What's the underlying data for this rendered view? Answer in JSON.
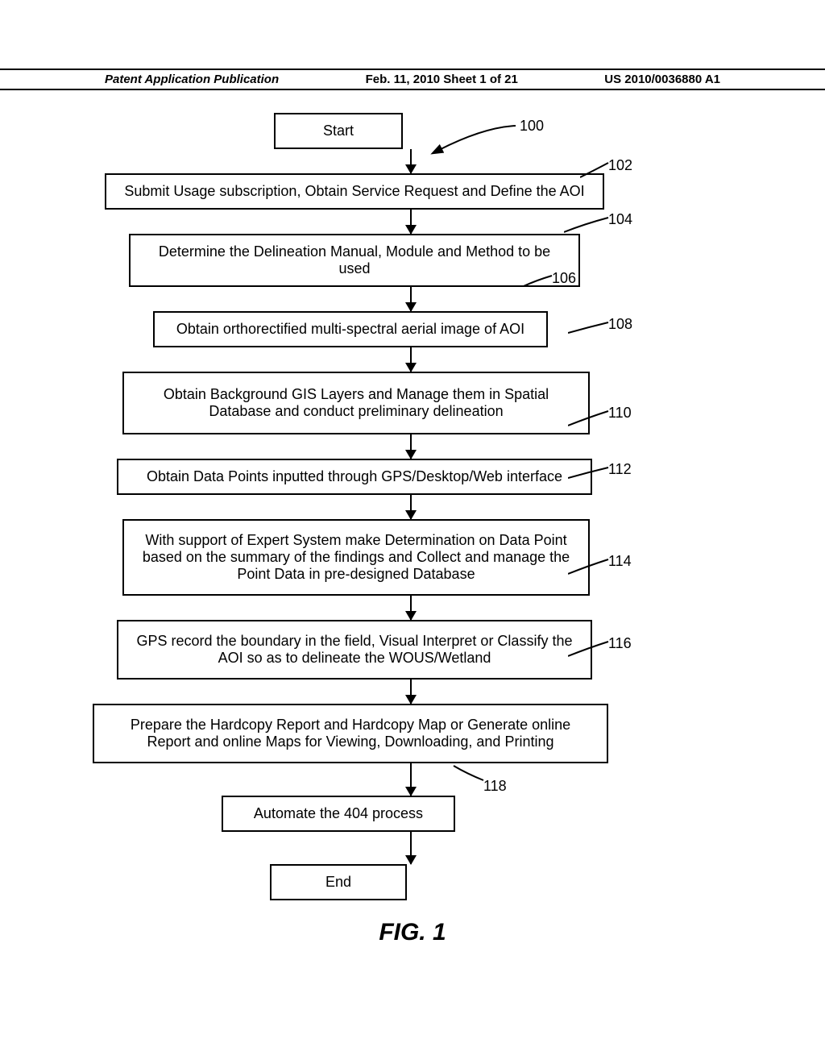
{
  "header": {
    "left": "Patent Application Publication",
    "center": "Feb. 11, 2010  Sheet 1 of 21",
    "right": "US 2010/0036880 A1"
  },
  "boxes": {
    "start": "Start",
    "b102": "Submit Usage subscription, Obtain Service Request and Define the AOI",
    "b104": "Determine the Delineation Manual, Module and Method to be used",
    "b106": "Obtain orthorectified multi-spectral aerial image of AOI",
    "b108": "Obtain Background GIS Layers and Manage them in Spatial Database and conduct preliminary delineation",
    "b110": "Obtain Data Points inputted through GPS/Desktop/Web interface",
    "b112": "With support of Expert System make Determination on Data Point based on the summary of the findings and Collect and manage the Point Data in pre-designed Database",
    "b114": "GPS record the boundary in the field, Visual Interpret or Classify the AOI so as to delineate the WOUS/Wetland",
    "b116": "Prepare the Hardcopy Report and Hardcopy Map or Generate online Report and online Maps for Viewing, Downloading, and Printing",
    "b118": "Automate the 404 process",
    "end": "End"
  },
  "refs": {
    "r100": "100",
    "r102": "102",
    "r104": "104",
    "r106": "106",
    "r108": "108",
    "r110": "110",
    "r112": "112",
    "r114": "114",
    "r116": "116",
    "r118": "118"
  },
  "figure_label": "FIG. 1",
  "chart_data": {
    "type": "flowchart",
    "title": "FIG. 1",
    "nodes": [
      {
        "id": "start",
        "ref": null,
        "label": "Start",
        "shape": "rect"
      },
      {
        "id": "102",
        "ref": "102",
        "label": "Submit Usage subscription, Obtain Service Request and Define the AOI",
        "shape": "rect"
      },
      {
        "id": "104",
        "ref": "104",
        "label": "Determine the Delineation Manual, Module and Method to be used",
        "shape": "rect"
      },
      {
        "id": "106",
        "ref": "106",
        "label": "Obtain orthorectified multi-spectral aerial image of AOI",
        "shape": "rect"
      },
      {
        "id": "108",
        "ref": "108",
        "label": "Obtain Background GIS Layers and Manage them in Spatial Database and conduct preliminary delineation",
        "shape": "rect"
      },
      {
        "id": "110",
        "ref": "110",
        "label": "Obtain Data Points inputted through GPS/Desktop/Web interface",
        "shape": "rect"
      },
      {
        "id": "112",
        "ref": "112",
        "label": "With support of Expert System make Determination on Data Point based on the summary of the findings and Collect and manage the Point Data in pre-designed Database",
        "shape": "rect"
      },
      {
        "id": "114",
        "ref": "114",
        "label": "GPS record the boundary in the field, Visual Interpret or Classify the AOI so as to delineate the WOUS/Wetland",
        "shape": "rect"
      },
      {
        "id": "116",
        "ref": "116",
        "label": "Prepare the Hardcopy Report and Hardcopy Map or Generate online Report and online Maps for Viewing, Downloading, and Printing",
        "shape": "rect"
      },
      {
        "id": "118",
        "ref": "118",
        "label": "Automate the 404 process",
        "shape": "rect"
      },
      {
        "id": "end",
        "ref": null,
        "label": "End",
        "shape": "rect"
      }
    ],
    "edges": [
      {
        "from": "start",
        "to": "102"
      },
      {
        "from": "102",
        "to": "104"
      },
      {
        "from": "104",
        "to": "106"
      },
      {
        "from": "106",
        "to": "108"
      },
      {
        "from": "108",
        "to": "110"
      },
      {
        "from": "110",
        "to": "112"
      },
      {
        "from": "112",
        "to": "114"
      },
      {
        "from": "114",
        "to": "116"
      },
      {
        "from": "116",
        "to": "118"
      },
      {
        "from": "118",
        "to": "end"
      }
    ],
    "overall_ref": "100"
  }
}
